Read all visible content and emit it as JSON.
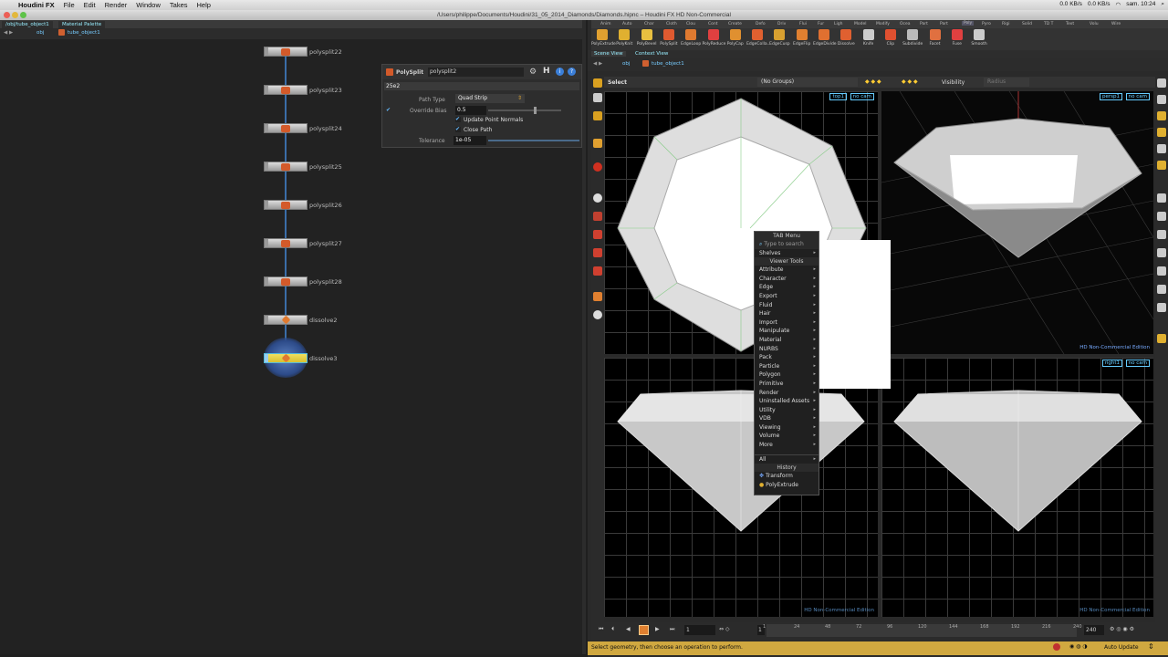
{
  "menubar": {
    "app": "Houdini FX",
    "items": [
      "File",
      "Edit",
      "Render",
      "Window",
      "Takes",
      "Help"
    ],
    "status": {
      "net_down": "0.0 KB/s",
      "net_up": "0.0 KB/s",
      "clock": "sam. 10:24"
    }
  },
  "window": {
    "title": "/Users/philippe/Documents/Houdini/31_05_2014_Diamonds/Diamonds.hipnc – Houdini FX HD Non-Commercial"
  },
  "left_pane": {
    "tabs": [
      "/obj/tube_object1",
      "Material Palette"
    ],
    "path": [
      "obj",
      "tube_object1"
    ]
  },
  "nodes": [
    {
      "name": "polysplit22"
    },
    {
      "name": "polysplit23"
    },
    {
      "name": "polysplit24"
    },
    {
      "name": "polysplit25"
    },
    {
      "name": "polysplit26"
    },
    {
      "name": "polysplit27"
    },
    {
      "name": "polysplit28"
    },
    {
      "name": "dissolve2"
    },
    {
      "name": "dissolve3"
    }
  ],
  "params": {
    "type": "PolySplit",
    "node_name": "polysplit2",
    "group": "25e2",
    "path_type_label": "Path Type",
    "path_type_value": "Quad Strip",
    "override_bias_label": "Override Bias",
    "override_bias_value": "0.5",
    "update_normals_label": "Update Point Normals",
    "close_path_label": "Close Path",
    "tolerance_label": "Tolerance",
    "tolerance_value": "1e-05"
  },
  "shelf": {
    "items": [
      {
        "label": "PolyExtrude",
        "icon": "polyextrude-icon",
        "color": "#e0a030"
      },
      {
        "label": "PolyKnit",
        "icon": "polyknit-icon",
        "color": "#e0b030"
      },
      {
        "label": "PolyBevel",
        "icon": "polybevel-icon",
        "color": "#e8c040"
      },
      {
        "label": "PolySplit",
        "icon": "polysplit-icon",
        "color": "#e05a30"
      },
      {
        "label": "EdgeLoop",
        "icon": "edgeloop-icon",
        "color": "#e07a30"
      },
      {
        "label": "PolyReduce",
        "icon": "polyreduce-icon",
        "color": "#e04040"
      },
      {
        "label": "PolyCap",
        "icon": "polycap-icon",
        "color": "#e09030"
      },
      {
        "label": "EdgeColla...",
        "icon": "edgecollapse-icon",
        "color": "#e06030"
      },
      {
        "label": "EdgeCusp",
        "icon": "edgecusp-icon",
        "color": "#d8a030"
      },
      {
        "label": "EdgeFlip",
        "icon": "edgeflip-icon",
        "color": "#e08030"
      },
      {
        "label": "EdgeDivide",
        "icon": "edgedivide-icon",
        "color": "#e07030"
      },
      {
        "label": "Dissolve",
        "icon": "dissolve-icon",
        "color": "#e06030"
      },
      {
        "label": "Knife",
        "icon": "knife-icon",
        "color": "#cccccc"
      },
      {
        "label": "Clip",
        "icon": "clip-icon",
        "color": "#e05030"
      },
      {
        "label": "Subdivide",
        "icon": "subdivide-icon",
        "color": "#bbbbbb"
      },
      {
        "label": "Facet",
        "icon": "facet-icon",
        "color": "#e07040"
      },
      {
        "label": "Fuse",
        "icon": "fuse-icon",
        "color": "#e04040"
      },
      {
        "label": "Smooth",
        "icon": "smooth-icon",
        "color": "#cccccc"
      }
    ],
    "tabs": [
      "Anim",
      "Auto",
      "Char",
      "Cloth",
      "Clou",
      "Cont",
      "Create",
      "Defo",
      "Driv",
      "Flui",
      "Fur",
      "Ligh",
      "Model",
      "Modify",
      "Ocea",
      "Part",
      "Part",
      "Poly",
      "Pyro",
      "Rigi",
      "Solid",
      "TD T",
      "Text",
      "Volu",
      "Wire"
    ]
  },
  "viewer": {
    "tabs": [
      "Scene View",
      "Context View"
    ],
    "path": [
      "obj",
      "tube_object1"
    ],
    "select_label": "Select",
    "groups_value": "(No Groups)",
    "visibility_label": "Visibility",
    "radius_label": "Radius",
    "views": {
      "top": {
        "label": "top1",
        "cam": "no cam"
      },
      "persp": {
        "label": "persp1",
        "cam": "no cam"
      },
      "right": {
        "label": "right1",
        "cam": "no cam"
      }
    },
    "watermark": "HD Non-Commercial Edition"
  },
  "tab_menu": {
    "title": "TAB Menu",
    "search_placeholder": "Type to search",
    "shelves": "Shelves",
    "viewer_tools_header": "Viewer Tools",
    "items": [
      "Attribute",
      "Character",
      "Edge",
      "Export",
      "Fluid",
      "Hair",
      "Import",
      "Manipulate",
      "Material",
      "NURBS",
      "Pack",
      "Particle",
      "Polygon",
      "Primitive",
      "Render",
      "Uninstalled Assets",
      "Utility",
      "VDB",
      "Viewing",
      "Volume",
      "More"
    ],
    "all": "All",
    "history_header": "History",
    "history": [
      "Transform",
      "PolyExtrude"
    ]
  },
  "timeline": {
    "current_frame": "1",
    "start_frame": "1",
    "end_frame": "240",
    "ticks": [
      "1",
      "24",
      "48",
      "72",
      "96",
      "120",
      "144",
      "168",
      "192",
      "216",
      "240"
    ]
  },
  "status": {
    "message": "Select geometry, then choose an operation to perform.",
    "auto_update": "Auto Update"
  }
}
